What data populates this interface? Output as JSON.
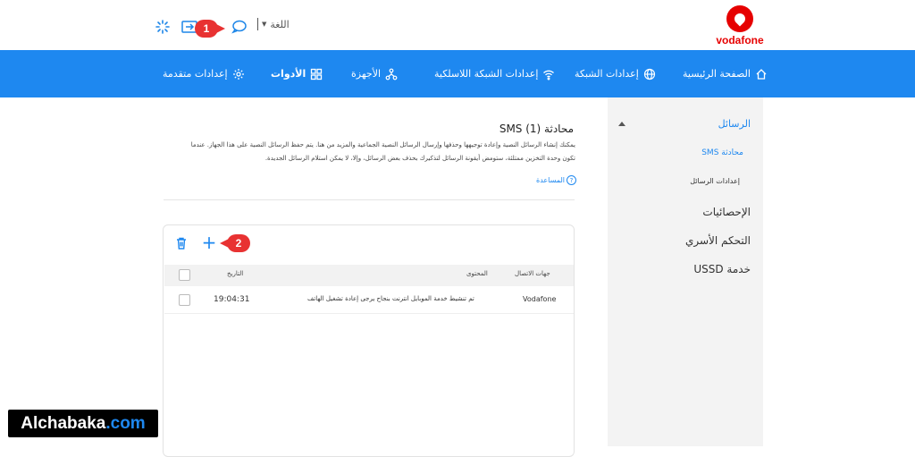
{
  "header": {
    "brand": "vodafone",
    "language_label": "اللغة",
    "icons": [
      "spinner-icon",
      "sim-card-icon",
      "chat-bubble-icon"
    ]
  },
  "annotations": {
    "badge1": "1",
    "badge2": "2"
  },
  "nav": {
    "items": [
      {
        "label": "الصفحة الرئيسية",
        "icon": "home-icon"
      },
      {
        "label": "إعدادات الشبكة",
        "icon": "globe-icon"
      },
      {
        "label": "إعدادات الشبكة اللاسلكية",
        "icon": "wifi-icon"
      },
      {
        "label": "الأجهزة",
        "icon": "devices-icon"
      },
      {
        "label": "الأدوات",
        "icon": "tools-grid-icon",
        "active": true
      },
      {
        "label": "إعدادات متقدمة",
        "icon": "gear-icon"
      }
    ]
  },
  "sidebar": {
    "messages": "الرسائل",
    "sms_conversation": "محادثة SMS",
    "message_settings": "إعدادات الرسائل",
    "statistics": "الإحصائيات",
    "parental_control": "التحكم الأسري",
    "ussd": "خدمة USSD"
  },
  "main": {
    "title": "محادثة SMS (1)",
    "description_line1": "يمكنك إنشاء الرسائل النصية وإعادة توجيهها وحذفها وإرسال الرسائل النصية الجماعية والمزيد من هنا. يتم حفظ الرسائل النصية على هذا الجهاز. عندما",
    "description_line2": "تكون وحدة التخزين ممتلئة، ستومض أيقونة الرسائل لتذكيرك بحذف بعض الرسائل، وإلا، لا يمكن استلام الرسائل الجديدة.",
    "help": "المساعدة",
    "help_icon": "?"
  },
  "table": {
    "headers": {
      "contacts": "جهات الاتصال",
      "content": "المحتوى",
      "date": "التاريخ"
    },
    "rows": [
      {
        "contact": "Vodafone",
        "content": "تم تنشيط خدمة الموبايل انترنت بنجاح يرجى إعادة تشغيل الهاتف",
        "date": "19:04:31"
      }
    ]
  },
  "watermark": {
    "part1": "Alchabaka",
    "part2": ".com"
  }
}
